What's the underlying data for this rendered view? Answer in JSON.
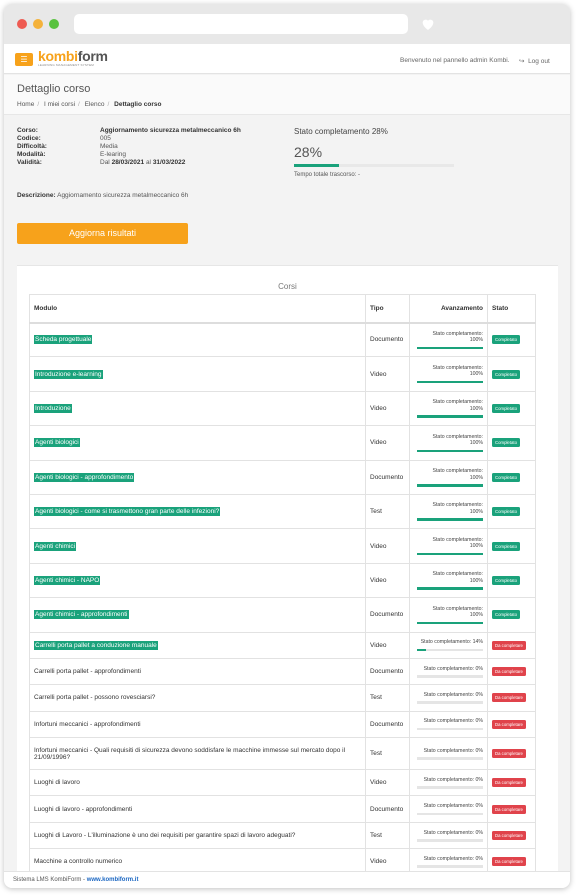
{
  "header": {
    "logo_kombi": "kombi",
    "logo_form": "form",
    "logo_sub": "LEARNING MANAGEMENT SYSTEM",
    "welcome": "Benvenuto nel pannello admin Kombi.",
    "logout": "Log out"
  },
  "page": {
    "title": "Dettaglio corso",
    "breadcrumb": [
      "Home",
      "I miei corsi",
      "Elenco",
      "Dettaglio corso"
    ]
  },
  "info": {
    "corso_label": "Corso:",
    "corso": "Aggiornamento sicurezza metalmeccanico 6h",
    "codice_label": "Codice:",
    "codice": "005",
    "difficolta_label": "Difficoltà:",
    "difficolta": "Media",
    "modalita_label": "Modalità:",
    "modalita": "E-learing",
    "validita_label": "Validità:",
    "validita_dal": "Dal",
    "validita_from": "28/03/2021",
    "validita_al": "al",
    "validita_to": "31/03/2022",
    "descrizione_label": "Descrizione:",
    "descrizione": "Aggiornamento sicurezza metalmeccanico 6h"
  },
  "status": {
    "title": "Stato completamento 28%",
    "pct_text": "28%",
    "pct": 28,
    "time": "Tempo totale trascorso: -"
  },
  "actions": {
    "update": "Aggiorna risultati"
  },
  "table": {
    "title": "Corsi",
    "headers": {
      "modulo": "Modulo",
      "tipo": "Tipo",
      "avanzamento": "Avanzamento",
      "stato": "Stato"
    },
    "progress_label": "Stato completamento:",
    "rows": [
      {
        "modulo": "Scheda progettuale",
        "tipo": "Documento",
        "pct": "100%",
        "stato": "Completato"
      },
      {
        "modulo": "Introduzione e-learning",
        "tipo": "Video",
        "pct": "100%",
        "stato": "Completato"
      },
      {
        "modulo": "Introduzione",
        "tipo": "Video",
        "pct": "100%",
        "stato": "Completato"
      },
      {
        "modulo": "Agenti biologici",
        "tipo": "Video",
        "pct": "100%",
        "stato": "Completato"
      },
      {
        "modulo": "Agenti biologici - approfondimento",
        "tipo": "Documento",
        "pct": "100%",
        "stato": "Completato"
      },
      {
        "modulo": "Agenti biologici - come si trasmettono gran parte delle infezioni?",
        "tipo": "Test",
        "pct": "100%",
        "stato": "Completato"
      },
      {
        "modulo": "Agenti chimici",
        "tipo": "Video",
        "pct": "100%",
        "stato": "Completato"
      },
      {
        "modulo": "Agenti chimici - NAPO",
        "tipo": "Video",
        "pct": "100%",
        "stato": "Completato"
      },
      {
        "modulo": "Agenti chimici - approfondimenti",
        "tipo": "Documento",
        "pct": "100%",
        "stato": "Completato"
      },
      {
        "modulo": "Carrelli porta pallet a conduzione manuale",
        "tipo": "Video",
        "pct": "14%",
        "stato": "Da completare"
      },
      {
        "modulo": "Carrelli porta pallet - approfondimenti",
        "tipo": "Documento",
        "pct": "0%",
        "stato": "Da completare"
      },
      {
        "modulo": "Carrelli porta pallet - possono rovesciarsi?",
        "tipo": "Test",
        "pct": "0%",
        "stato": "Da completare"
      },
      {
        "modulo": "Infortuni meccanici - approfondimenti",
        "tipo": "Documento",
        "pct": "0%",
        "stato": "Da completare"
      },
      {
        "modulo": "Infortuni meccanici - Quali requisiti di sicurezza devono soddisfare le macchine immesse sul mercato dopo il 21/09/1996?",
        "tipo": "Test",
        "pct": "0%",
        "stato": "Da completare"
      },
      {
        "modulo": "Luoghi di lavoro",
        "tipo": "Video",
        "pct": "0%",
        "stato": "Da completare"
      },
      {
        "modulo": "Luoghi di lavoro - approfondimenti",
        "tipo": "Documento",
        "pct": "0%",
        "stato": "Da completare"
      },
      {
        "modulo": "Luoghi di Lavoro - L'illuminazione è uno dei requisiti per garantire spazi di lavoro adeguati?",
        "tipo": "Test",
        "pct": "0%",
        "stato": "Da completare"
      },
      {
        "modulo": "Macchine a controllo numerico",
        "tipo": "Video",
        "pct": "0%",
        "stato": "Da completare"
      }
    ]
  },
  "footer": {
    "text": "Sistema LMS KombiForm - ",
    "link": "www.kombiform.it"
  },
  "colors": {
    "accent": "#f7a21b",
    "success": "#1aa27b",
    "danger": "#e0434b"
  }
}
